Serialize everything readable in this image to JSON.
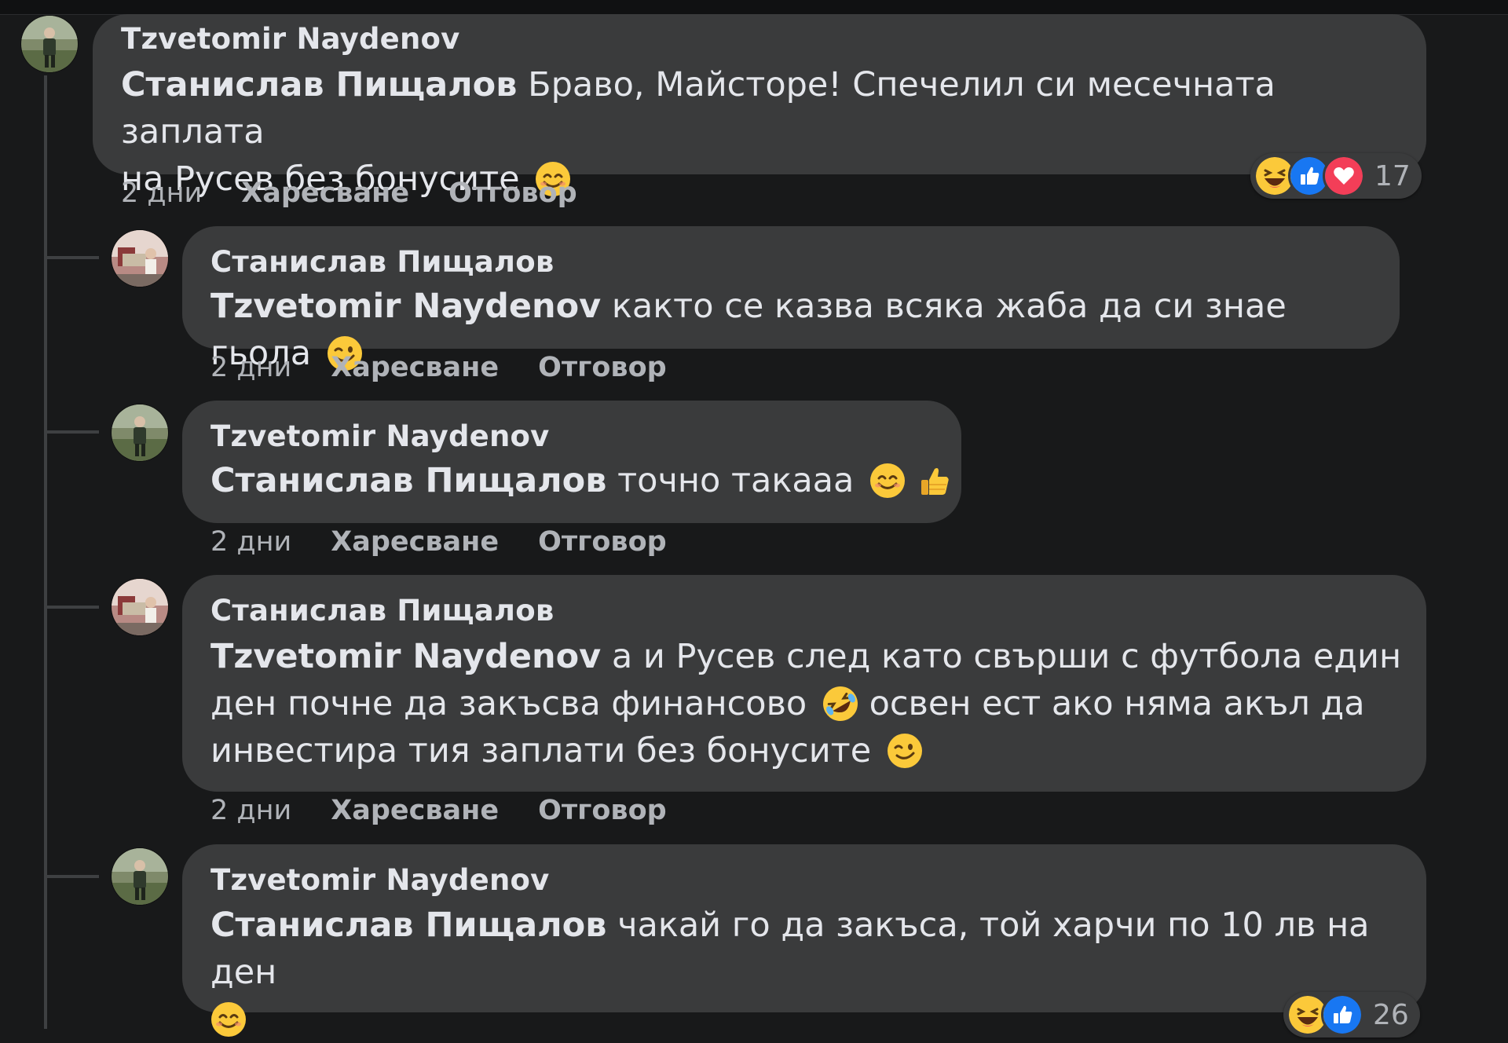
{
  "thread": {
    "parent": {
      "author": "Tzvetomir Naydenov",
      "mention": "Станислав Пищалов",
      "text_line1": "Браво, Майсторе! Спечелил си месечната заплата",
      "text_line2": "на Русев без бонусите",
      "time": "2 дни",
      "like_label": "Харесване",
      "reply_label": "Отговор",
      "reaction_count": "17",
      "reactions": [
        "haha-icon",
        "like-icon",
        "love-icon"
      ]
    },
    "replies": [
      {
        "author": "Станислав Пищалов",
        "mention": "Tzvetomir Naydenov",
        "text_line1": "както се казва всяка жаба да си знае гьола",
        "time": "2 дни",
        "like_label": "Харесване",
        "reply_label": "Отговор"
      },
      {
        "author": "Tzvetomir Naydenov",
        "mention": "Станислав Пищалов",
        "text_line1": "точно такааа",
        "time": "2 дни",
        "like_label": "Харесване",
        "reply_label": "Отговор"
      },
      {
        "author": "Станислав Пищалов",
        "mention": "Tzvetomir Naydenov",
        "text_line1": "а и Русев след като свърши с футбола един",
        "text_line2a": "ден почне да закъсва финансово",
        "text_line2b": "освен ест ако няма акъл да",
        "text_line3": "инвестира тия заплати без бонусите",
        "time": "2 дни",
        "like_label": "Харесване",
        "reply_label": "Отговор"
      },
      {
        "author": "Tzvetomir Naydenov",
        "mention": "Станислав Пищалов",
        "text_line1": "чакай го да закъса, той харчи по 10 лв на ден",
        "reaction_count": "26",
        "reactions": [
          "haha-icon",
          "like-icon"
        ]
      }
    ]
  },
  "colors": {
    "background": "#18191a",
    "bubble": "#3a3b3c",
    "text": "#e4e6eb",
    "secondary_text": "#b0b3b8",
    "like_blue": "#1877f2",
    "love_red": "#f33e58",
    "emoji_yellow": "#fbc93a"
  }
}
